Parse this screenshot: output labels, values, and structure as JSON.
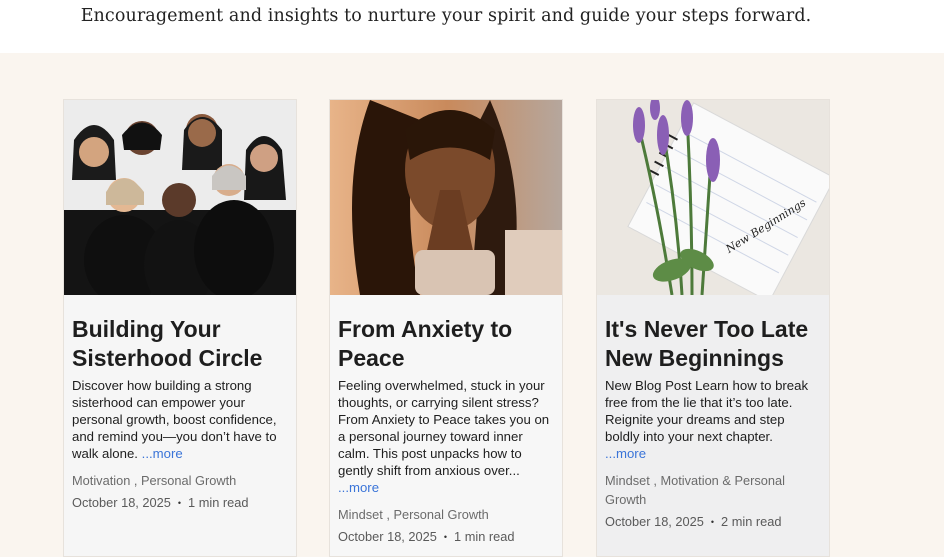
{
  "tagline": "Encouragement and insights to nurture your spirit and guide your steps forward.",
  "posts": [
    {
      "title": "Building Your Sisterhood Circle",
      "excerpt": "Discover how building a strong sisterhood can empower your personal growth, boost confidence, and remind you—you don’t have to walk alone.",
      "more": "...more",
      "categories": "Motivation , Personal Growth",
      "date": "October 18, 2025",
      "read_time": "1 min read",
      "image": "women-group-laughing-photo"
    },
    {
      "title": "From Anxiety to Peace",
      "excerpt": "Feeling overwhelmed, stuck in your thoughts, or carrying silent stress? From Anxiety to Peace takes you on a personal journey toward inner calm. This post unpacks how to gently shift from anxious over...",
      "more": "...more",
      "categories": "Mindset , Personal Growth",
      "date": "October 18, 2025",
      "read_time": "1 min read",
      "image": "woman-praying-photo"
    },
    {
      "title": "It's Never Too Late New Beginnings",
      "excerpt": "New Blog Post Learn how to break free from the lie that it’s too late. Reignite your dreams and step boldly into your next chapter.",
      "more": "...more",
      "categories": "Mindset , Motivation & Personal Growth",
      "date": "October 18, 2025",
      "read_time": "2 min read",
      "image": "lavender-notebook-photo",
      "notebook_text": "New Beginnings"
    }
  ],
  "separator": "•"
}
